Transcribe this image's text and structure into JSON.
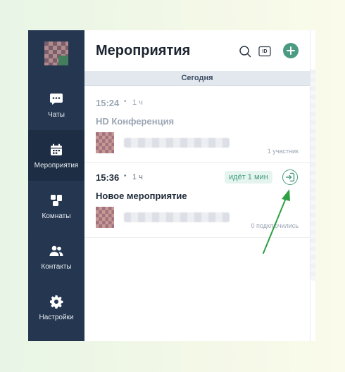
{
  "sidebar": {
    "items": [
      {
        "label": "Чаты",
        "icon": "chat-icon"
      },
      {
        "label": "Мероприятия",
        "icon": "calendar-icon",
        "active": true
      },
      {
        "label": "Комнаты",
        "icon": "rooms-icon"
      },
      {
        "label": "Контакты",
        "icon": "contacts-icon"
      },
      {
        "label": "Настройки",
        "icon": "settings-icon"
      }
    ]
  },
  "header": {
    "title": "Мероприятия",
    "search_icon": "search-icon",
    "id_label": "ID",
    "add_icon": "plus-icon"
  },
  "list": {
    "section": "Сегодня",
    "events": [
      {
        "time": "15:24",
        "separator": "•",
        "duration": "1 ч",
        "title": "HD Конференция",
        "participants": "1 участник",
        "state": "past"
      },
      {
        "time": "15:36",
        "separator": "•",
        "duration": "1 ч",
        "title": "Новое мероприятие",
        "status": "идёт 1 мин",
        "participants": "0 подключились",
        "join_icon": "join-icon",
        "state": "live"
      }
    ]
  },
  "colors": {
    "sidebar_bg": "#253750",
    "sidebar_active": "#1d2d43",
    "accent": "#4b9b83",
    "badge_bg": "#e6f4ef",
    "arrow": "#2ea043"
  }
}
